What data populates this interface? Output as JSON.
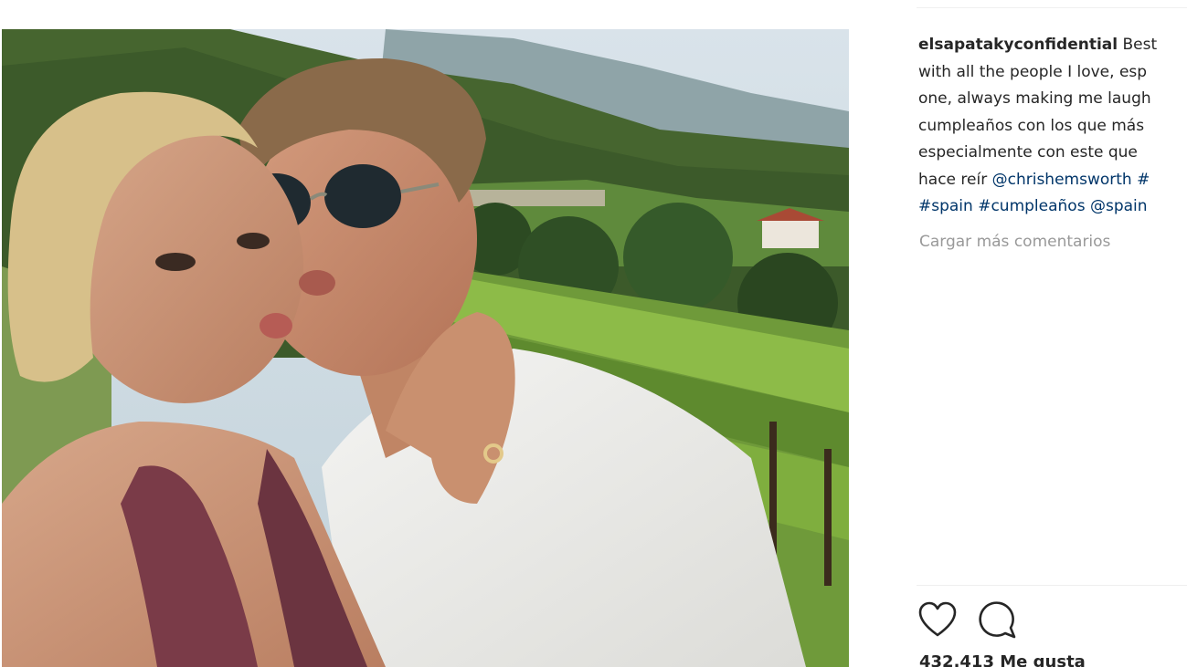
{
  "post": {
    "username": "elsapatakyconfidential",
    "caption_lines": [
      "Best",
      "with all the people I love, esp",
      "one, always making me laugh",
      "cumpleaños con los que más",
      "especialmente con este que",
      "hace reír"
    ],
    "caption_mention": "@chrishemsworth",
    "caption_line6_tail": "#",
    "caption_hashtags": [
      "#spain",
      "#cumpleaños",
      "@spain"
    ],
    "load_more_comments": "Cargar más comentarios",
    "likes_count": "432.413",
    "likes_label": "Me gusta"
  },
  "icons": {
    "like": "heart-icon",
    "comment": "comment-bubble-icon"
  },
  "colors": {
    "text": "#262626",
    "link": "#003569",
    "muted": "#999999",
    "divider": "#efefef"
  }
}
